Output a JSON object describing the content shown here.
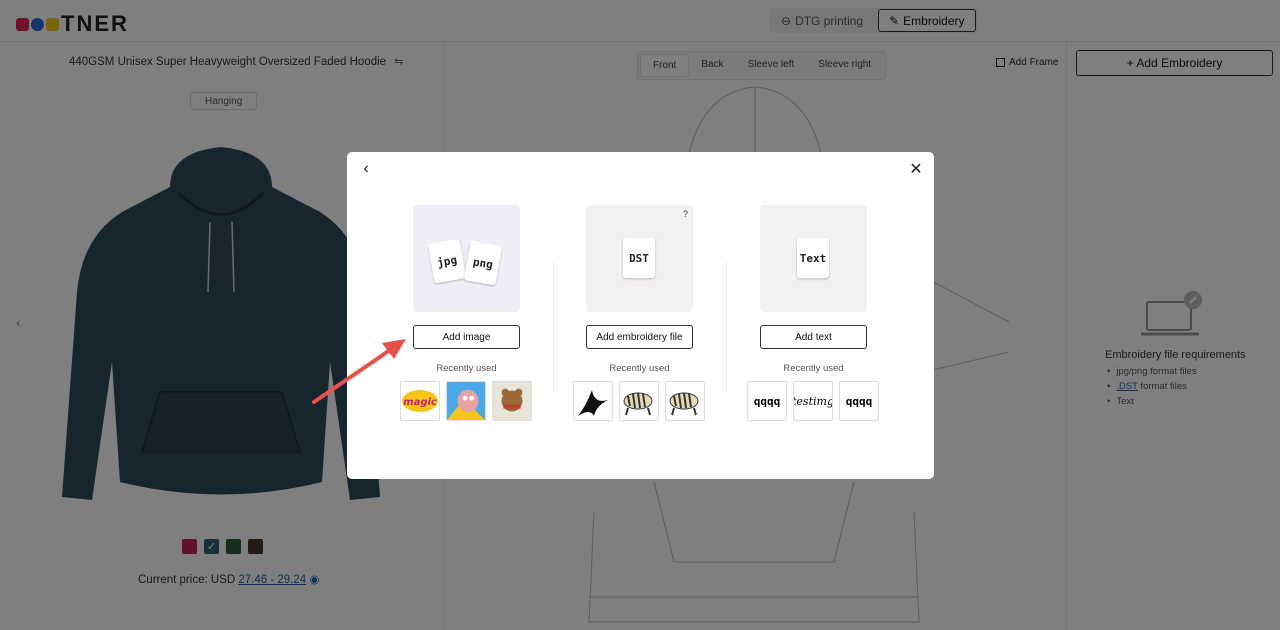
{
  "header": {
    "logo_text": "TNER",
    "logo_colors": [
      "#e0234e",
      "#2d6bd9",
      "#f5c218"
    ],
    "modes": [
      {
        "label": "DTG printing",
        "icon": "print-icon",
        "active": false
      },
      {
        "label": "Embroidery",
        "icon": "needle-icon",
        "active": true
      }
    ]
  },
  "product": {
    "title": "440GSM Unisex Super Heavyweight Oversized Faded Hoodie",
    "view_chip": "Hanging",
    "hoodie_color": "#2e4a5c",
    "swatches": [
      {
        "color": "#c0275a",
        "selected": false
      },
      {
        "color": "#355f7d",
        "selected": true,
        "check": "✓"
      },
      {
        "color": "#2e5d3c",
        "selected": false
      },
      {
        "color": "#4a3427",
        "selected": false
      }
    ],
    "price_label": "Current price: USD",
    "price_range": "27.46 - 29.24"
  },
  "canvas": {
    "tabs": [
      {
        "label": "Front",
        "active": true
      },
      {
        "label": "Back",
        "active": false
      },
      {
        "label": "Sleeve left",
        "active": false
      },
      {
        "label": "Sleeve right",
        "active": false
      }
    ],
    "add_frame_label": "Add Frame"
  },
  "sidebar": {
    "add_button_label": "+ Add Embroidery",
    "requirements_title": "Embroidery file requirements",
    "requirements": [
      {
        "prefix": "",
        "highlight": "",
        "text": "jpg/png format files"
      },
      {
        "prefix": "",
        "highlight": ".DST",
        "text": " format files"
      },
      {
        "prefix": "",
        "highlight": "",
        "text": "Text"
      }
    ]
  },
  "modal": {
    "options": [
      {
        "id": "image",
        "tile_color": "#efedf5",
        "file_labels": [
          "jpg",
          "png"
        ],
        "button_label": "Add image",
        "recent_label": "Recently used",
        "recent": [
          "magic",
          "cartoon-face",
          "bear-photo"
        ]
      },
      {
        "id": "dst",
        "tile_color": "#f3f0f0",
        "file_labels": [
          "DST"
        ],
        "help": "?",
        "button_label": "Add embroidery file",
        "recent_label": "Recently used",
        "recent": [
          "bird-silhouette",
          "zebra",
          "zebra"
        ]
      },
      {
        "id": "text",
        "tile_color": "#f2f1ee",
        "file_labels": [
          "Text"
        ],
        "button_label": "Add text",
        "recent_label": "Recently used",
        "recent_text": [
          "qqqq",
          "testimg",
          "qqqq"
        ]
      }
    ]
  }
}
